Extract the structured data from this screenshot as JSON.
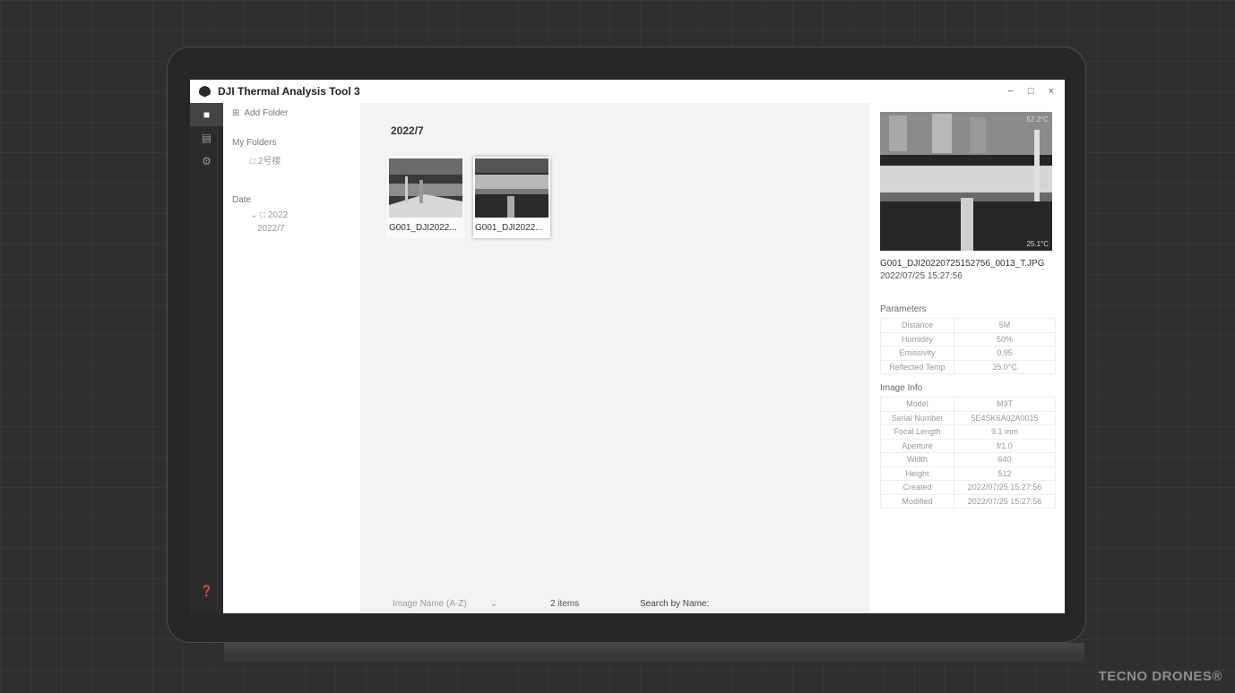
{
  "app": {
    "title": "DJI Thermal Analysis Tool 3",
    "window_controls": [
      "−",
      "□",
      "×"
    ]
  },
  "sidebar": {
    "add_folder": "Add Folder",
    "my_folders_label": "My Folders",
    "my_folders": [
      "2号楼"
    ],
    "date_label": "Date",
    "years": [
      {
        "label": "2022",
        "months": [
          "2022/7"
        ]
      }
    ]
  },
  "main": {
    "group_title": "2022/7",
    "thumbnails": [
      {
        "name": "G001_DJI2022..."
      },
      {
        "name": "G001_DJI2022..."
      }
    ],
    "sort_label": "Image Name (A-Z)",
    "count_text": "2 items",
    "search_label": "Search by Name:"
  },
  "details": {
    "preview_max_temp": "57.2°C",
    "preview_min_temp": "25.1°C",
    "filename": "G001_DJI20220725152756_0013_T.JPG",
    "datetime": "2022/07/25 15:27:56",
    "parameters_title": "Parameters",
    "parameters": [
      {
        "key": "Distance",
        "value": "5M"
      },
      {
        "key": "Humidity",
        "value": "50%"
      },
      {
        "key": "Emissivity",
        "value": "0.95"
      },
      {
        "key": "Reflected Temp",
        "value": "35.0°C"
      }
    ],
    "image_info_title": "Image Info",
    "image_info": [
      {
        "key": "Model",
        "value": "M3T"
      },
      {
        "key": "Serial Number",
        "value": "5E4SK6A02A0015"
      },
      {
        "key": "Focal Length",
        "value": "9.1 mm"
      },
      {
        "key": "Aperture",
        "value": "f/1.0"
      },
      {
        "key": "Width",
        "value": "640"
      },
      {
        "key": "Height",
        "value": "512"
      },
      {
        "key": "Created",
        "value": "2022/07/25 15:27:56"
      },
      {
        "key": "Modified",
        "value": "2022/07/25 15:27:56"
      }
    ]
  },
  "watermark": "TECNO DRONES®"
}
